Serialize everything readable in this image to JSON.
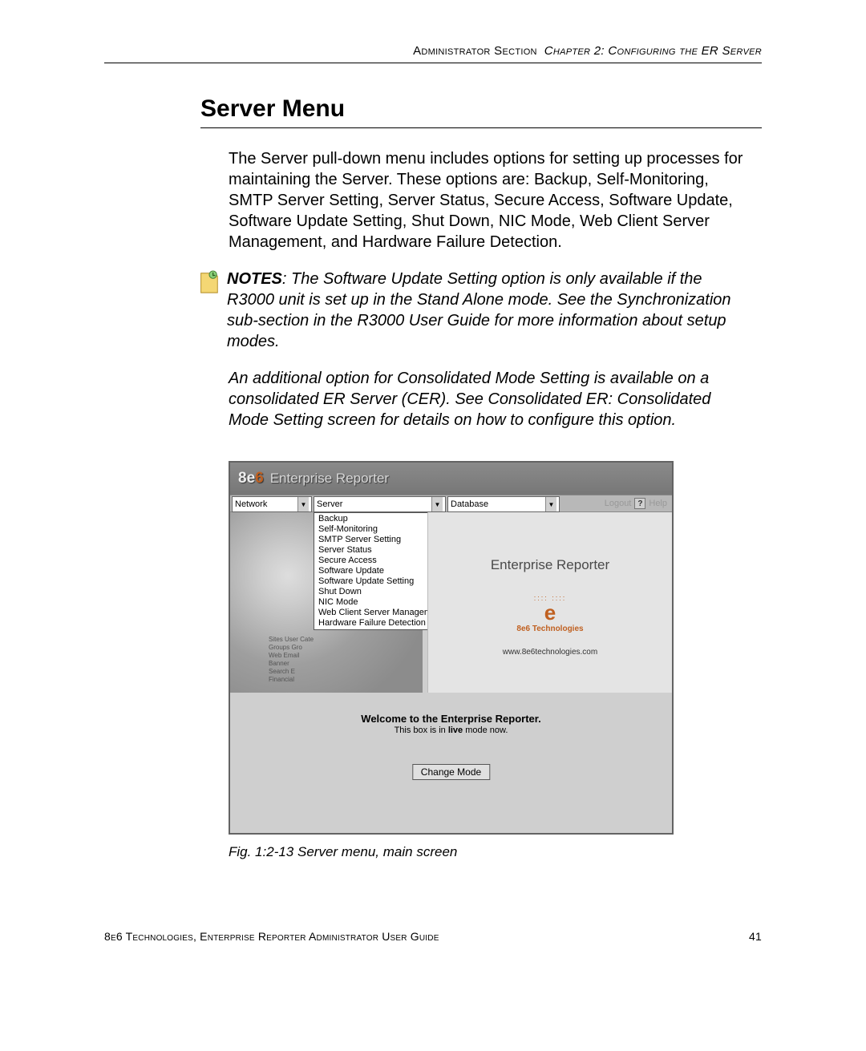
{
  "header": {
    "section": "Administrator Section",
    "chapter": "Chapter 2: Configuring the ER Server"
  },
  "title": "Server Menu",
  "intro": "The Server pull-down menu includes options for setting up processes for maintaining the Server. These options are: Backup, Self-Monitoring, SMTP Server Setting, Server Status, Secure Access, Software Update, Software Update Setting, Shut Down, NIC Mode, Web Client Server Management, and Hardware Failure Detection.",
  "notes": {
    "label": "NOTES",
    "p1": ": The Software Update Setting option is only available if the R3000 unit is set up in the Stand Alone mode. See the Synchronization sub-section in the R3000 User Guide for more information about setup modes.",
    "p2": "An additional option for Consolidated Mode Setting is available on a consolidated ER Server (CER). See Consolidated ER: Consolidated Mode Setting screen for details on how to configure this option."
  },
  "app": {
    "brand_prefix": "8e",
    "brand_suffix": "6",
    "product": "Enterprise Reporter",
    "menus": {
      "network": "Network",
      "server": "Server",
      "database": "Database"
    },
    "topright": {
      "logout": "Logout",
      "help_glyph": "?",
      "help": "Help"
    },
    "server_dropdown": [
      "Backup",
      "Self-Monitoring",
      "SMTP Server Setting",
      "Server Status",
      "Secure Access",
      "Software Update",
      "Software Update Setting",
      "Shut Down",
      "NIC Mode",
      "Web Client Server Management",
      "Hardware Failure Detection"
    ],
    "bg_labels": {
      "l1": "Sites   User   Cate",
      "l2": "Groups  Gro",
      "l3": "Web Email",
      "l4": "Banner",
      "l5": "Search E",
      "l6": "Financial"
    },
    "right": {
      "title": "Enterprise Reporter",
      "dots": "::::   ::::",
      "e": "e",
      "tech": "8e6 Technologies",
      "url": "www.8e6technologies.com"
    },
    "welcome": {
      "line1": "Welcome to the Enterprise Reporter.",
      "line2a": "This box is in ",
      "line2b": "live",
      "line2c": " mode now."
    },
    "change_mode": "Change Mode"
  },
  "caption": "Fig. 1:2-13  Server menu, main screen",
  "footer": {
    "left": "8e6 Technologies, Enterprise Reporter Administrator User Guide",
    "right": "41"
  }
}
